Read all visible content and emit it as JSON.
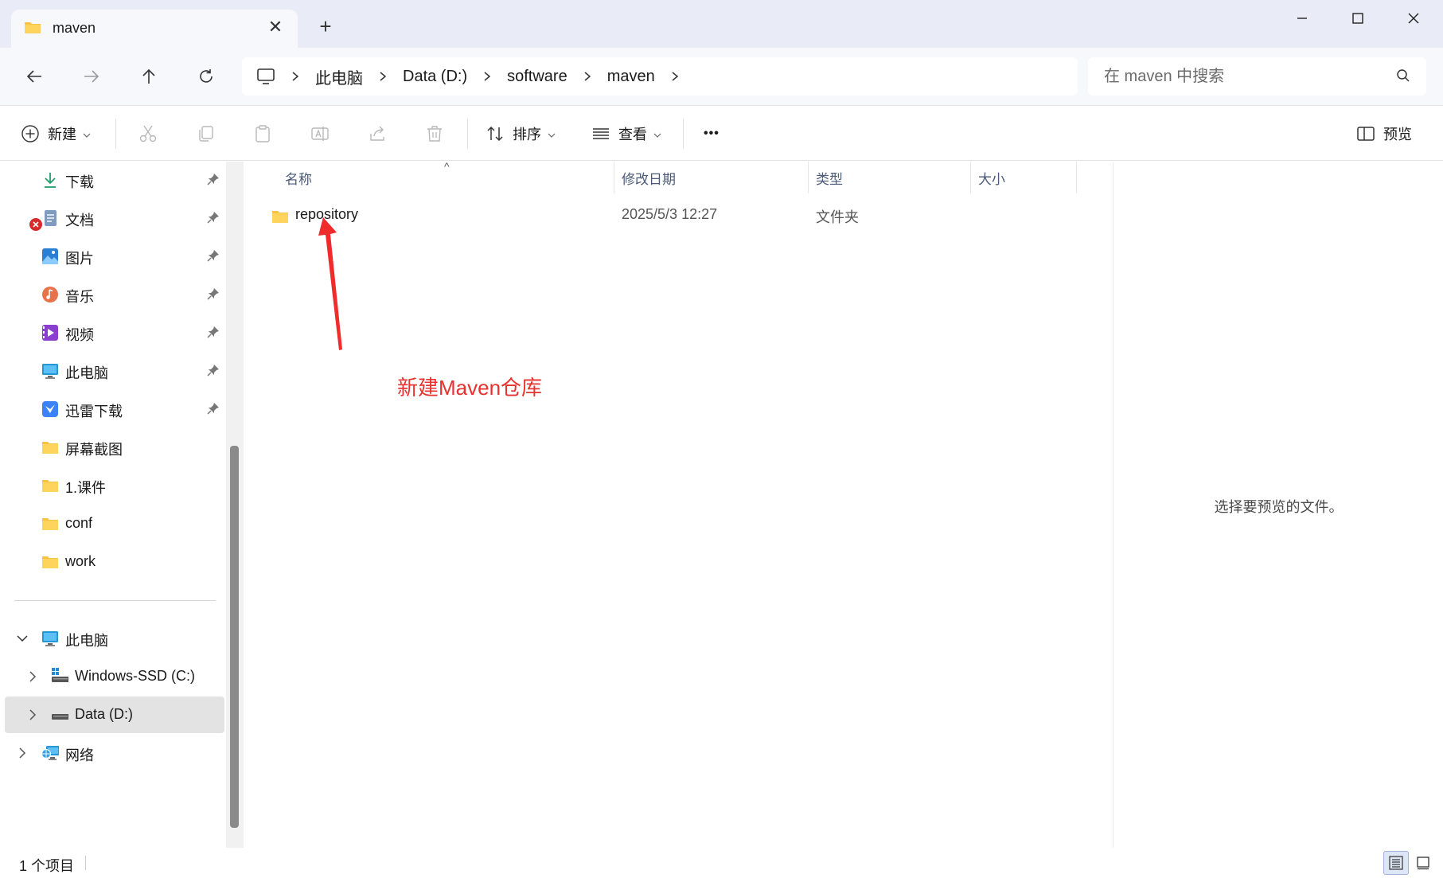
{
  "window": {
    "tab_title": "maven",
    "tab_close": "✕",
    "new_tab": "+"
  },
  "breadcrumb": {
    "items": [
      "此电脑",
      "Data (D:)",
      "software",
      "maven"
    ]
  },
  "search": {
    "placeholder": "在 maven 中搜索"
  },
  "toolbar": {
    "new_label": "新建",
    "sort_label": "排序",
    "view_label": "查看",
    "more_label": "•••",
    "preview_label": "预览"
  },
  "sidebar": {
    "quick_access": [
      {
        "label": "下载",
        "icon": "download-icon",
        "pinned": true
      },
      {
        "label": "文档",
        "icon": "documents-icon",
        "pinned": true,
        "badge": "error"
      },
      {
        "label": "图片",
        "icon": "pictures-icon",
        "pinned": true
      },
      {
        "label": "音乐",
        "icon": "music-icon",
        "pinned": true
      },
      {
        "label": "视频",
        "icon": "video-icon",
        "pinned": true
      },
      {
        "label": "此电脑",
        "icon": "computer-icon",
        "pinned": true
      },
      {
        "label": "迅雷下载",
        "icon": "thunder-icon",
        "pinned": true
      },
      {
        "label": "屏幕截图",
        "icon": "folder-icon",
        "pinned": false
      },
      {
        "label": "1.课件",
        "icon": "folder-icon",
        "pinned": false
      },
      {
        "label": "conf",
        "icon": "folder-icon",
        "pinned": false
      },
      {
        "label": "work",
        "icon": "folder-icon",
        "pinned": false
      }
    ],
    "tree": [
      {
        "label": "此电脑",
        "icon": "computer-icon",
        "expanded": true
      },
      {
        "label": "Windows-SSD (C:)",
        "icon": "drive-c-icon",
        "expanded": false
      },
      {
        "label": "Data (D:)",
        "icon": "drive-d-icon",
        "expanded": false,
        "selected": true
      },
      {
        "label": "网络",
        "icon": "network-icon",
        "expanded": false
      }
    ]
  },
  "table": {
    "columns": [
      "名称",
      "修改日期",
      "类型",
      "大小"
    ],
    "sort_indicator": "^",
    "rows": [
      {
        "name": "repository",
        "modified": "2025/5/3 12:27",
        "type": "文件夹",
        "size": ""
      }
    ]
  },
  "annotation": {
    "text": "新建Maven仓库",
    "color": "#e8322f"
  },
  "preview": {
    "message": "选择要预览的文件。"
  },
  "status": {
    "item_count": "1 个项目"
  },
  "colors": {
    "accent": "#0067c0",
    "folder": "#f6c343",
    "selected_bg": "#e3e3e3"
  }
}
